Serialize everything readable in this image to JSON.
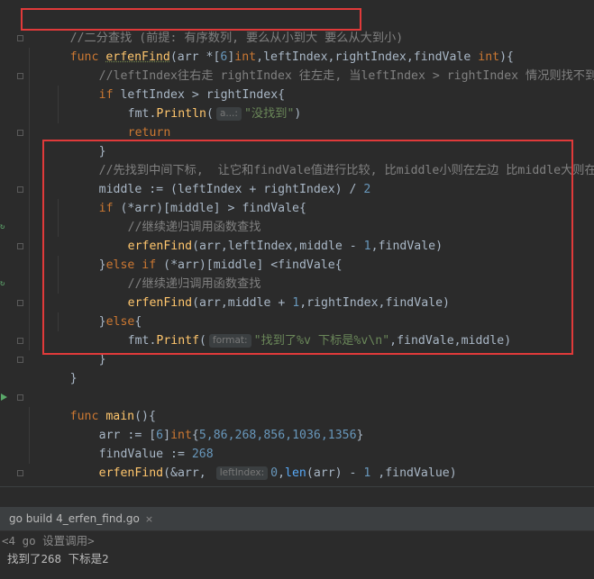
{
  "editor": {
    "lines": {
      "l1": "//二分查找 (前提: 有序数列, 要么从小到大 要么从大到小)",
      "l2_kw": "func ",
      "l2_fn": "erfenFind",
      "l2_a": "(arr *[",
      "l2_n": "6",
      "l2_b": "]",
      "l2_t": "int",
      "l2_c": ",leftIndex,rightIndex,findVale ",
      "l2_t2": "int",
      "l2_d": "){",
      "l3": "//leftIndex往右走 rightIndex 往左走, 当leftIndex > rightIndex 情况则找不到",
      "l4_kw": "if ",
      "l4_rest": "leftIndex > rightIndex{",
      "l5_pkg": "fmt.",
      "l5_fn": "Println",
      "l5_p": "(",
      "l5_hint": "a...:",
      "l5_str": "\"没找到\"",
      "l5_end": ")",
      "l6": "return",
      "l7": "}",
      "l8": "//先找到中间下标,  让它和findVale值进行比较, 比middle小则在左边 比middle大则在右边",
      "l9_a": "middle := (leftIndex + rightIndex) / ",
      "l9_n": "2",
      "l10_kw": "if ",
      "l10_rest": "(*arr)[middle] > findVale{",
      "l11": "//继续递归调用函数查找",
      "l12_fn": "erfenFind",
      "l12_a": "(arr,leftIndex,middle - ",
      "l12_n": "1",
      "l12_b": ",findVale)",
      "l13_a": "}",
      "l13_kw": "else if ",
      "l13_rest": "(*arr)[middle] <findVale{",
      "l14": "//继续递归调用函数查找",
      "l15_fn": "erfenFind",
      "l15_a": "(arr,middle + ",
      "l15_n": "1",
      "l15_b": ",rightIndex,findVale)",
      "l16_a": "}",
      "l16_kw": "else",
      "l16_b": "{",
      "l17_pkg": "fmt.",
      "l17_fn": "Printf",
      "l17_p": "(",
      "l17_hint": "format:",
      "l17_str": "\"找到了%v 下标是%v\\n\"",
      "l17_end": ",findVale,middle)",
      "l18": "}",
      "l19": "}",
      "l21_kw": "func ",
      "l21_fn": "main",
      "l21_rest": "(){",
      "l22_a": "arr := [",
      "l22_n": "6",
      "l22_b": "]",
      "l22_t": "int",
      "l22_c": "{",
      "l22_nums": "5,86,268,856,1036,1356",
      "l22_d": "}",
      "l23_a": "findValue := ",
      "l23_n": "268",
      "l24_fn": "erfenFind",
      "l24_a": "(&arr, ",
      "l24_hint": "leftIndex:",
      "l24_n": "0",
      "l24_b": ",",
      "l24_fn2": "len",
      "l24_c": "(arr) - ",
      "l24_n2": "1",
      "l24_d": " ,findValue)",
      "l25": "}"
    }
  },
  "run": {
    "tab_label": "go build 4_erfen_find.go",
    "tab_close": "×",
    "cmd": "<4 go 设置调用>",
    "output": "找到了268 下标是2"
  },
  "colors": {
    "highlight_box": "#e03a3a"
  }
}
